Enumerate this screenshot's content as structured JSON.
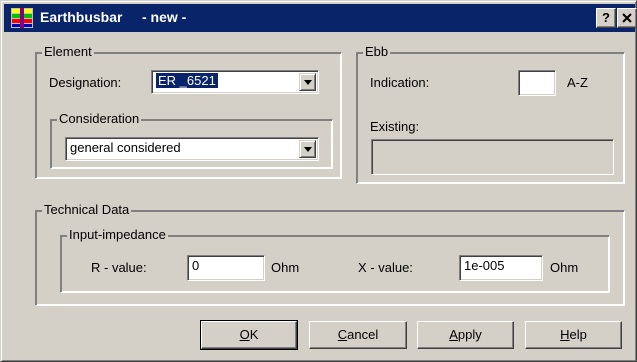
{
  "window": {
    "title": "Earthbusbar",
    "subtitle": "- new -",
    "help_btn": "?",
    "close_btn": "✕"
  },
  "element_group": {
    "legend": "Element",
    "designation_label": "Designation:",
    "designation_value": "ER _6521",
    "consideration_legend": "Consideration",
    "consideration_value": "general considered"
  },
  "ebb_group": {
    "legend": "Ebb",
    "indication_label": "Indication:",
    "indication_value": "",
    "indication_range": "A-Z",
    "existing_label": "Existing:",
    "existing_value": ""
  },
  "technical_group": {
    "legend": "Technical Data",
    "impedance_legend": "Input-impedance",
    "r_label": "R - value:",
    "r_value": "0",
    "r_unit": "Ohm",
    "x_label": "X - value:",
    "x_value": "1e-005",
    "x_unit": "Ohm"
  },
  "buttons": {
    "ok_mnemonic": "O",
    "ok_rest": "K",
    "cancel_mnemonic": "C",
    "cancel_rest": "ancel",
    "apply_mnemonic": "A",
    "apply_rest": "pply",
    "help_mnemonic": "H",
    "help_rest": "elp"
  },
  "colors": {
    "title_bar": "#0a246a",
    "face": "#d4d0c8",
    "selection": "#0a246a"
  },
  "icons": {
    "app": "earthbusbar-icon",
    "dropdown": "chevron-down-icon"
  }
}
